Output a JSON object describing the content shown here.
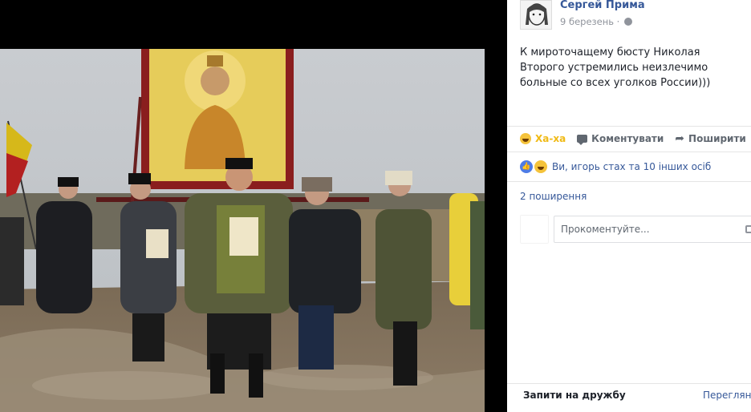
{
  "post": {
    "author": "Сергей Прима",
    "date": "9 березень ·",
    "text": "К мироточащему бюсту Николая Второго устремились неизлечимо больные со всех уголков России)))"
  },
  "actions": {
    "reaction_label": "Ха-ха",
    "comment_label": "Коментувати",
    "share_label": "Поширити"
  },
  "reactions_summary": "Ви, игорь стах та 10 інших осіб",
  "shares_count": "2 поширення",
  "comment_input": {
    "placeholder": "Прокоментуйте..."
  },
  "friend_requests": {
    "title": "Запити на дружбу",
    "link": "Переглянути"
  },
  "colors": {
    "link": "#365899",
    "haha": "#f0ba15",
    "text": "#1d2129",
    "muted": "#90949c"
  },
  "icons": [
    "globe-icon",
    "haha-emoji-icon",
    "comment-icon",
    "share-icon",
    "like-icon",
    "camera-icon"
  ]
}
